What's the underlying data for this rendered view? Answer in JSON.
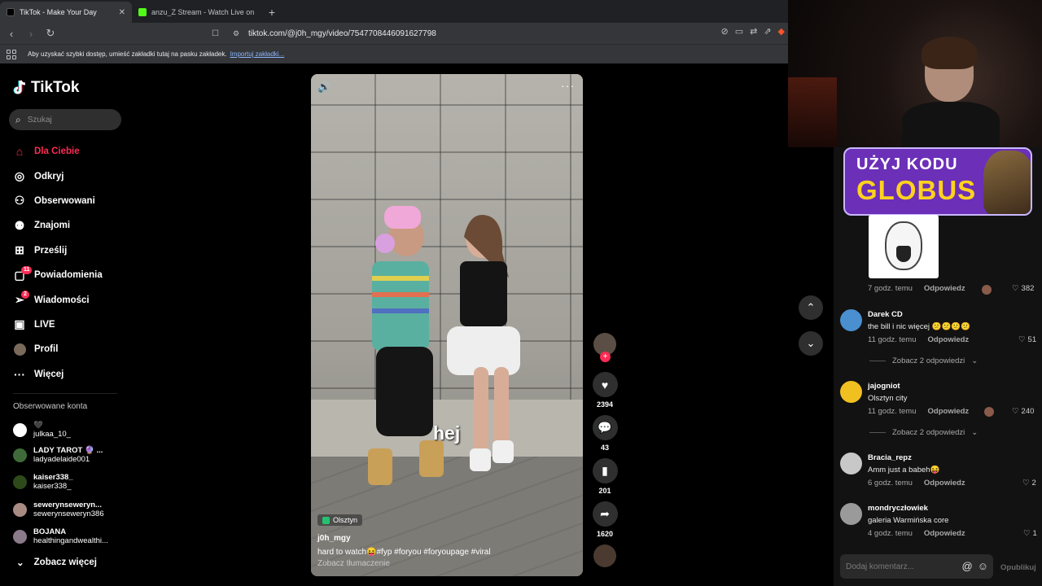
{
  "tabs": [
    {
      "title": "TikTok - Make Your Day",
      "active": true
    },
    {
      "title": "anzu_Z Stream - Watch Live on Kick",
      "active": false
    }
  ],
  "url": "tiktok.com/@j0h_mgy/video/7547708446091627798",
  "bookmarks_bar": {
    "text": "Aby uzyskać szybki dostęp, umieść zakładki tutaj na pasku zakładek.",
    "link": "Importuj zakładki..."
  },
  "sidebar": {
    "logo": "TikTok",
    "search_placeholder": "Szukaj",
    "items": [
      {
        "label": "Dla Ciebie",
        "icon": "home-icon",
        "active": true
      },
      {
        "label": "Odkryj",
        "icon": "compass-icon"
      },
      {
        "label": "Obserwowani",
        "icon": "following-icon"
      },
      {
        "label": "Znajomi",
        "icon": "friends-icon"
      },
      {
        "label": "Prześlij",
        "icon": "upload-icon"
      },
      {
        "label": "Powiadomienia",
        "icon": "notifications-icon",
        "badge": "11"
      },
      {
        "label": "Wiadomości",
        "icon": "messages-icon",
        "badge": "2"
      },
      {
        "label": "LIVE",
        "icon": "live-icon"
      },
      {
        "label": "Profil",
        "icon": "profile-icon"
      },
      {
        "label": "Więcej",
        "icon": "more-icon"
      }
    ],
    "followed_title": "Obserwowane konta",
    "followed": [
      {
        "name": "🖤",
        "handle": "julkaa_10_"
      },
      {
        "name": "LADY TAROT 🔮 ...",
        "handle": "ladyadelaide001"
      },
      {
        "name": "kaiser338_",
        "handle": "kaiser338_"
      },
      {
        "name": "sewerynseweryn...",
        "handle": "sewerynseweryn386"
      },
      {
        "name": "BOJANA",
        "handle": "healthingandwealthi..."
      }
    ],
    "see_more": "Zobacz więcej"
  },
  "video": {
    "subtitle": "hej",
    "location": "Olsztyn",
    "author": "j0h_mgy",
    "description": "hard to watch😝#fyp  #foryou  #foryoupage  #viral",
    "translate": "Zobacz tłumaczenie"
  },
  "actions": {
    "likes": "2394",
    "comments": "43",
    "saves": "201",
    "shares": "1620"
  },
  "promo": {
    "line1": "UŻYJ KODU",
    "line2": "GLOBUS"
  },
  "comments": [
    {
      "time": "7 godz. temu",
      "reply": "Odpowiedz",
      "likes": "382"
    },
    {
      "user": "Darek CD",
      "text": "the bill i nic więcej 😕😕😕😕",
      "time": "11 godz. temu",
      "reply": "Odpowiedz",
      "likes": "51",
      "more": "Zobacz 2 odpowiedzi"
    },
    {
      "user": "jajogniot",
      "text": "Olsztyn city",
      "time": "11 godz. temu",
      "reply": "Odpowiedz",
      "likes": "240",
      "more": "Zobacz 2 odpowiedzi"
    },
    {
      "user": "Bracia_repz",
      "text": "Amm just a babeh😝",
      "time": "6 godz. temu",
      "reply": "Odpowiedz",
      "likes": "2"
    },
    {
      "user": "mondryczłowiek",
      "text": "galeria Warmińska core",
      "time": "4 godz. temu",
      "reply": "Odpowiedz",
      "likes": "1"
    }
  ],
  "add_comment_placeholder": "Dodaj komentarz...",
  "publish": "Opublikuj",
  "colors": {
    "accent": "#fe2c55",
    "promo": "#6b2fb8",
    "promo_text": "#ffd21e"
  }
}
